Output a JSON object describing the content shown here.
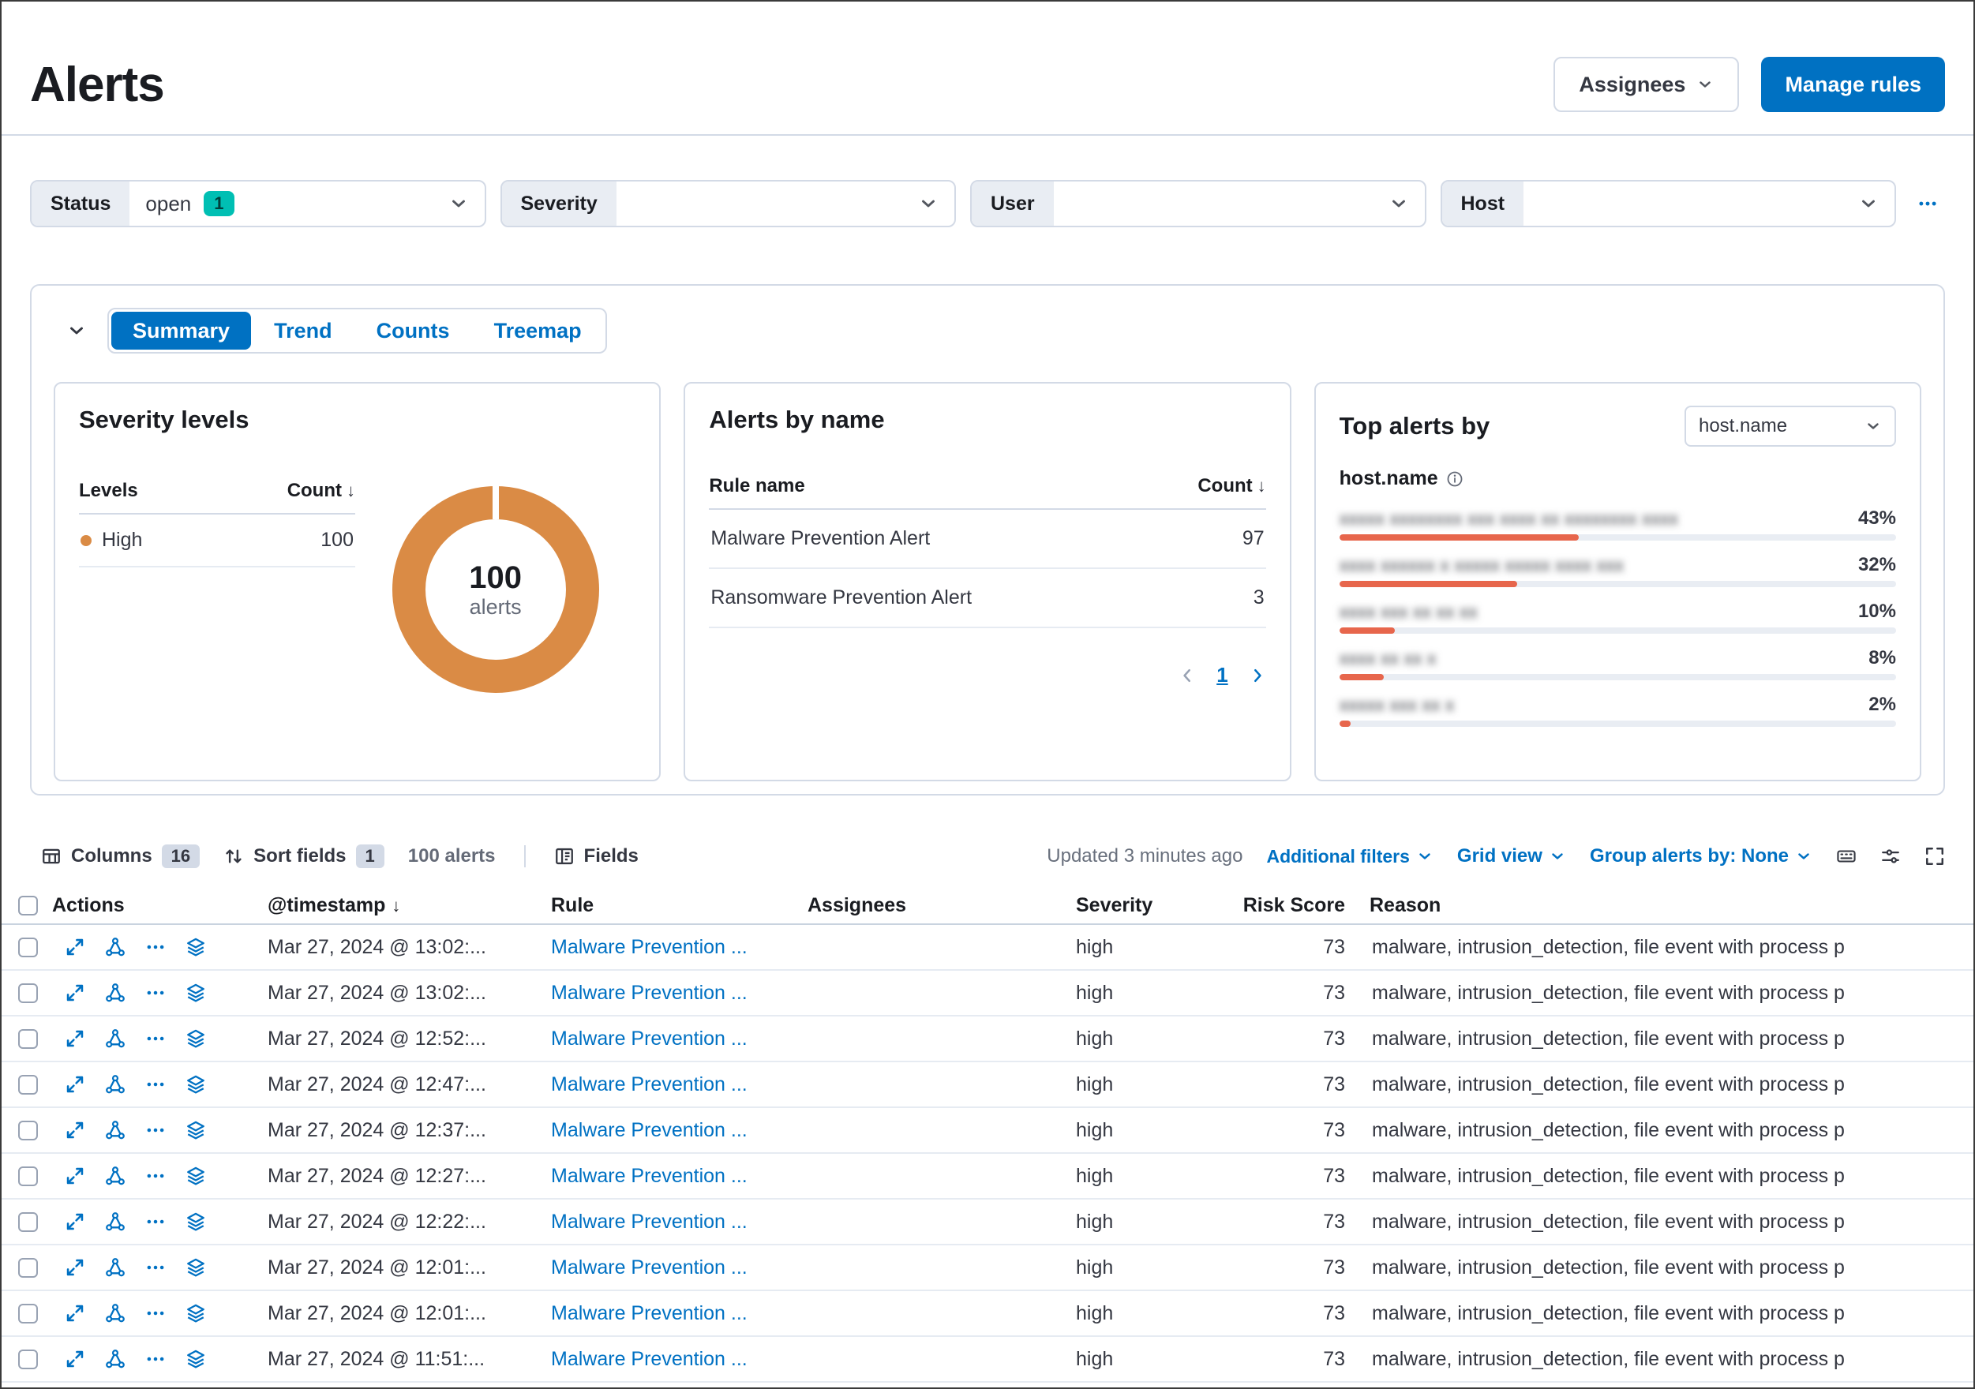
{
  "page": {
    "title": "Alerts"
  },
  "header": {
    "assignees_button": "Assignees",
    "manage_rules_button": "Manage rules"
  },
  "filter_bar": {
    "status": {
      "label": "Status",
      "value": "open",
      "badge": "1"
    },
    "severity": {
      "label": "Severity",
      "value": ""
    },
    "user": {
      "label": "User",
      "value": ""
    },
    "host": {
      "label": "Host",
      "value": ""
    }
  },
  "charts_panel": {
    "tabs": [
      "Summary",
      "Trend",
      "Counts",
      "Treemap"
    ],
    "active_tab": "Summary",
    "severity_levels": {
      "title": "Severity levels",
      "col_levels": "Levels",
      "col_count": "Count",
      "sort_arrow": "↓",
      "rows": [
        {
          "level": "High",
          "count": "100"
        }
      ],
      "donut_value": "100",
      "donut_unit": "alerts",
      "high_color": "#da8b45"
    },
    "alerts_by_name": {
      "title": "Alerts by name",
      "col_rule": "Rule name",
      "col_count": "Count",
      "sort_arrow": "↓",
      "rows": [
        {
          "rule": "Malware Prevention Alert",
          "count": "97"
        },
        {
          "rule": "Ransomware Prevention Alert",
          "count": "3"
        }
      ],
      "page": "1"
    },
    "top_alerts": {
      "title": "Top alerts by",
      "field_selector": "host.name",
      "field_label": "host.name",
      "bar_color": "#e7664c",
      "rows": [
        {
          "host_redacted": "xxxxx xxxxxxxx xxx xxxx xx xxxxxxxx xxxx",
          "percent": "43%",
          "value": 43
        },
        {
          "host_redacted": "xxxx xxxxxx x xxxxx xxxxx xxxx xxx",
          "percent": "32%",
          "value": 32
        },
        {
          "host_redacted": "xxxx xxx xx xx xx",
          "percent": "10%",
          "value": 10
        },
        {
          "host_redacted": "xxxx xx xx x",
          "percent": "8%",
          "value": 8
        },
        {
          "host_redacted": "xxxxx xxx xx x",
          "percent": "2%",
          "value": 2
        }
      ]
    }
  },
  "chart_data": [
    {
      "type": "pie",
      "title": "Severity levels",
      "categories": [
        "High"
      ],
      "values": [
        100
      ],
      "center_label": "100 alerts",
      "colors": [
        "#da8b45"
      ]
    },
    {
      "type": "table",
      "title": "Alerts by name",
      "columns": [
        "Rule name",
        "Count"
      ],
      "rows": [
        [
          "Malware Prevention Alert",
          97
        ],
        [
          "Ransomware Prevention Alert",
          3
        ]
      ]
    },
    {
      "type": "bar",
      "title": "Top alerts by host.name",
      "categories": [
        "redacted-1",
        "redacted-2",
        "redacted-3",
        "redacted-4",
        "redacted-5"
      ],
      "values": [
        43,
        32,
        10,
        8,
        2
      ],
      "unit": "%"
    }
  ],
  "table_toolbar": {
    "columns_label": "Columns",
    "columns_count": "16",
    "sort_label": "Sort fields",
    "sort_count": "1",
    "alerts_count": "100 alerts",
    "fields_label": "Fields",
    "updated": "Updated 3 minutes ago",
    "additional_filters": "Additional filters",
    "grid_view": "Grid view",
    "group_by": "Group alerts by: None"
  },
  "alerts_table": {
    "headers": {
      "actions": "Actions",
      "timestamp": "@timestamp",
      "timestamp_sort": "↓",
      "rule": "Rule",
      "assignees": "Assignees",
      "severity": "Severity",
      "risk_score": "Risk Score",
      "reason": "Reason"
    },
    "rows": [
      {
        "timestamp": "Mar 27, 2024 @ 13:02:...",
        "rule": "Malware Prevention ...",
        "severity": "high",
        "risk_score": "73",
        "reason": "malware, intrusion_detection, file event with process p"
      },
      {
        "timestamp": "Mar 27, 2024 @ 13:02:...",
        "rule": "Malware Prevention ...",
        "severity": "high",
        "risk_score": "73",
        "reason": "malware, intrusion_detection, file event with process p"
      },
      {
        "timestamp": "Mar 27, 2024 @ 12:52:...",
        "rule": "Malware Prevention ...",
        "severity": "high",
        "risk_score": "73",
        "reason": "malware, intrusion_detection, file event with process p"
      },
      {
        "timestamp": "Mar 27, 2024 @ 12:47:...",
        "rule": "Malware Prevention ...",
        "severity": "high",
        "risk_score": "73",
        "reason": "malware, intrusion_detection, file event with process p"
      },
      {
        "timestamp": "Mar 27, 2024 @ 12:37:...",
        "rule": "Malware Prevention ...",
        "severity": "high",
        "risk_score": "73",
        "reason": "malware, intrusion_detection, file event with process p"
      },
      {
        "timestamp": "Mar 27, 2024 @ 12:27:...",
        "rule": "Malware Prevention ...",
        "severity": "high",
        "risk_score": "73",
        "reason": "malware, intrusion_detection, file event with process p"
      },
      {
        "timestamp": "Mar 27, 2024 @ 12:22:...",
        "rule": "Malware Prevention ...",
        "severity": "high",
        "risk_score": "73",
        "reason": "malware, intrusion_detection, file event with process p"
      },
      {
        "timestamp": "Mar 27, 2024 @ 12:01:...",
        "rule": "Malware Prevention ...",
        "severity": "high",
        "risk_score": "73",
        "reason": "malware, intrusion_detection, file event with process p"
      },
      {
        "timestamp": "Mar 27, 2024 @ 12:01:...",
        "rule": "Malware Prevention ...",
        "severity": "high",
        "risk_score": "73",
        "reason": "malware, intrusion_detection, file event with process p"
      },
      {
        "timestamp": "Mar 27, 2024 @ 11:51:...",
        "rule": "Malware Prevention ...",
        "severity": "high",
        "risk_score": "73",
        "reason": "malware, intrusion_detection, file event with process p"
      }
    ]
  }
}
